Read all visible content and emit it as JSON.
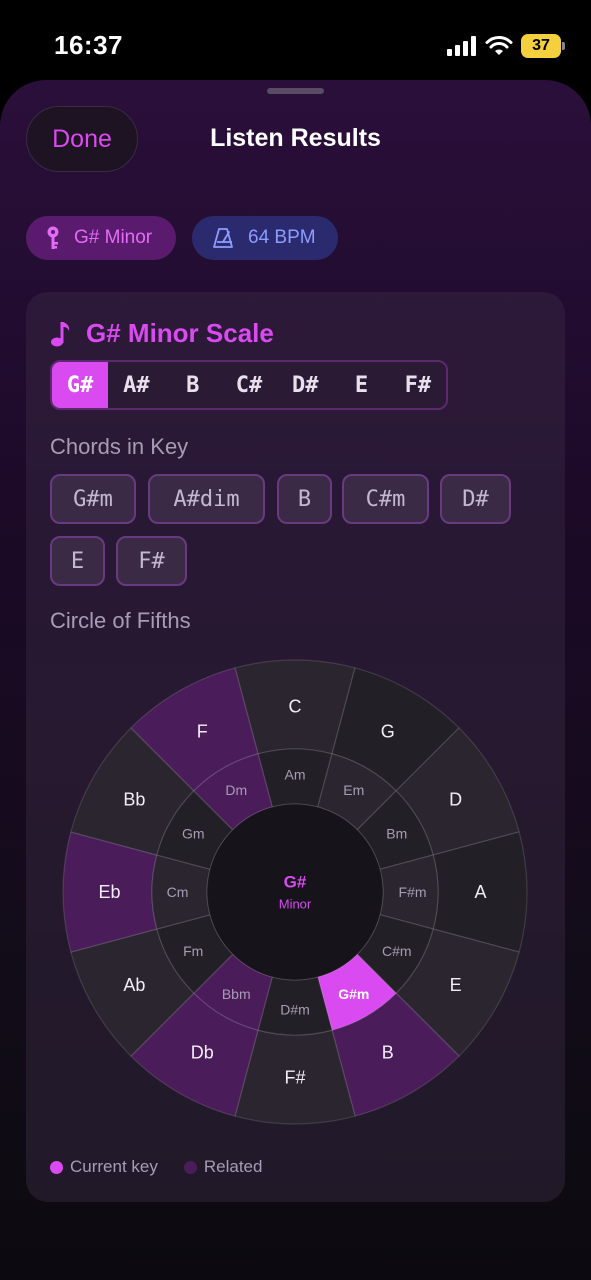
{
  "status": {
    "time": "16:37",
    "battery": "37"
  },
  "header": {
    "done_label": "Done",
    "title": "Listen Results"
  },
  "pills": {
    "key": "G# Minor",
    "bpm": "64 BPM"
  },
  "scale": {
    "title": "G# Minor Scale",
    "notes": [
      "G#",
      "A#",
      "B",
      "C#",
      "D#",
      "E",
      "F#"
    ],
    "active_index": 0
  },
  "chords": {
    "label": "Chords in Key",
    "items": [
      "G#m",
      "A#dim",
      "B",
      "C#m",
      "D#",
      "E",
      "F#"
    ]
  },
  "circle": {
    "label": "Circle of Fifths",
    "center_key": "G#",
    "center_mode": "Minor",
    "outer": [
      "C",
      "G",
      "D",
      "A",
      "E",
      "B",
      "F#",
      "Db",
      "Ab",
      "Eb",
      "Bb",
      "F"
    ],
    "inner": [
      "Am",
      "Em",
      "Bm",
      "F#m",
      "C#m",
      "G#m",
      "D#m",
      "Bbm",
      "Fm",
      "Cm",
      "Gm",
      "Dm"
    ],
    "outer_related": [
      5,
      7,
      9,
      11
    ],
    "inner_related": [
      7,
      11
    ],
    "inner_current": 5
  },
  "legend": {
    "current": "Current key",
    "related": "Related"
  },
  "colors": {
    "accent": "#d94af0",
    "related": "#4a1d5a",
    "segment_a": "#2a252f",
    "segment_b": "#221f27",
    "center": "#17131b"
  }
}
